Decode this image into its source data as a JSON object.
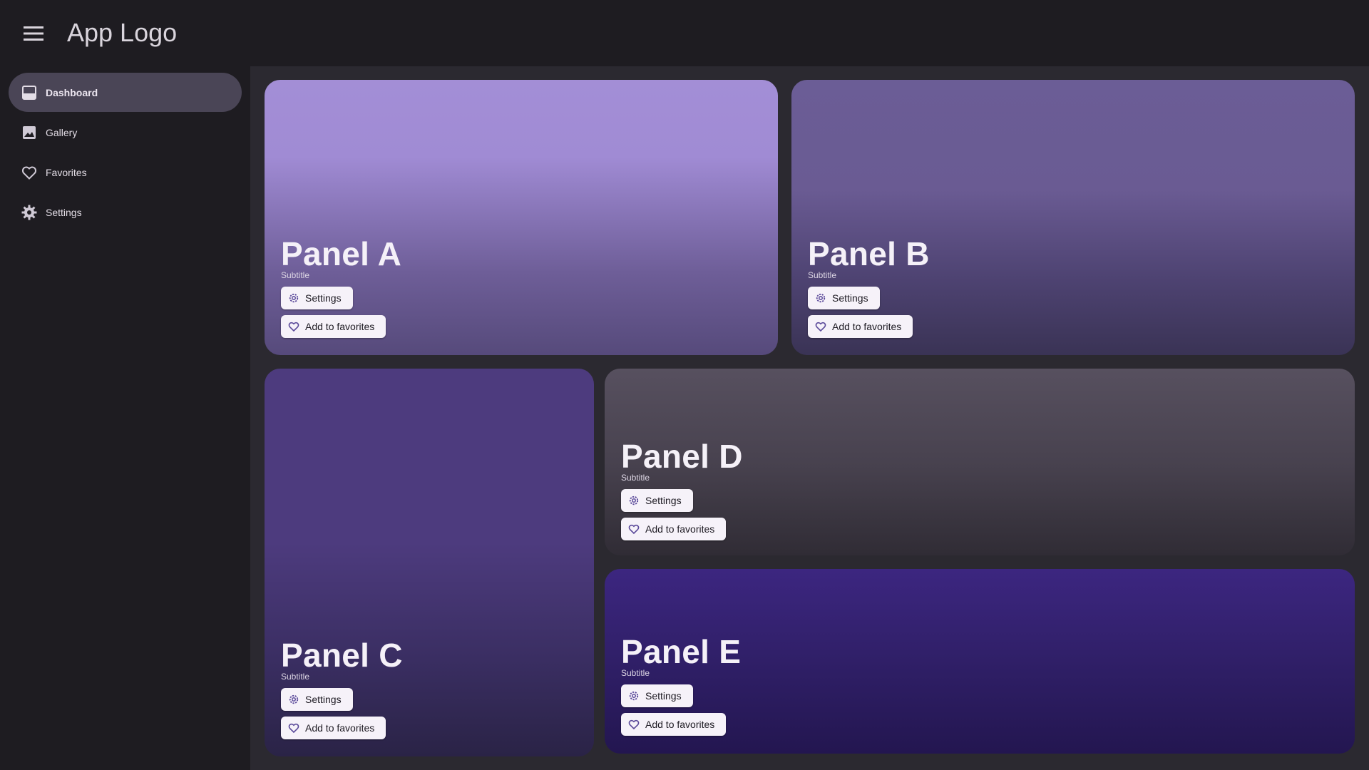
{
  "header": {
    "app_logo": "App Logo"
  },
  "sidebar": {
    "items": [
      {
        "label": "Dashboard",
        "icon": "dashboard-icon",
        "active": true
      },
      {
        "label": "Gallery",
        "icon": "image-icon",
        "active": false
      },
      {
        "label": "Favorites",
        "icon": "heart-icon",
        "active": false
      },
      {
        "label": "Settings",
        "icon": "gear-icon",
        "active": false
      }
    ]
  },
  "panels": [
    {
      "title": "Panel A",
      "subtitle": "Subtitle",
      "settings_label": "Settings",
      "favorites_label": "Add to favorites"
    },
    {
      "title": "Panel B",
      "subtitle": "Subtitle",
      "settings_label": "Settings",
      "favorites_label": "Add to favorites"
    },
    {
      "title": "Panel C",
      "subtitle": "Subtitle",
      "settings_label": "Settings",
      "favorites_label": "Add to favorites"
    },
    {
      "title": "Panel D",
      "subtitle": "Subtitle",
      "settings_label": "Settings",
      "favorites_label": "Add to favorites"
    },
    {
      "title": "Panel E",
      "subtitle": "Subtitle",
      "settings_label": "Settings",
      "favorites_label": "Add to favorites"
    }
  ],
  "colors": {
    "background": "#1e1c21",
    "content_background": "#2b2930",
    "active_nav": "#4a4556",
    "chip_background": "#f6f2f9",
    "chip_icon": "#5b4a9a"
  }
}
